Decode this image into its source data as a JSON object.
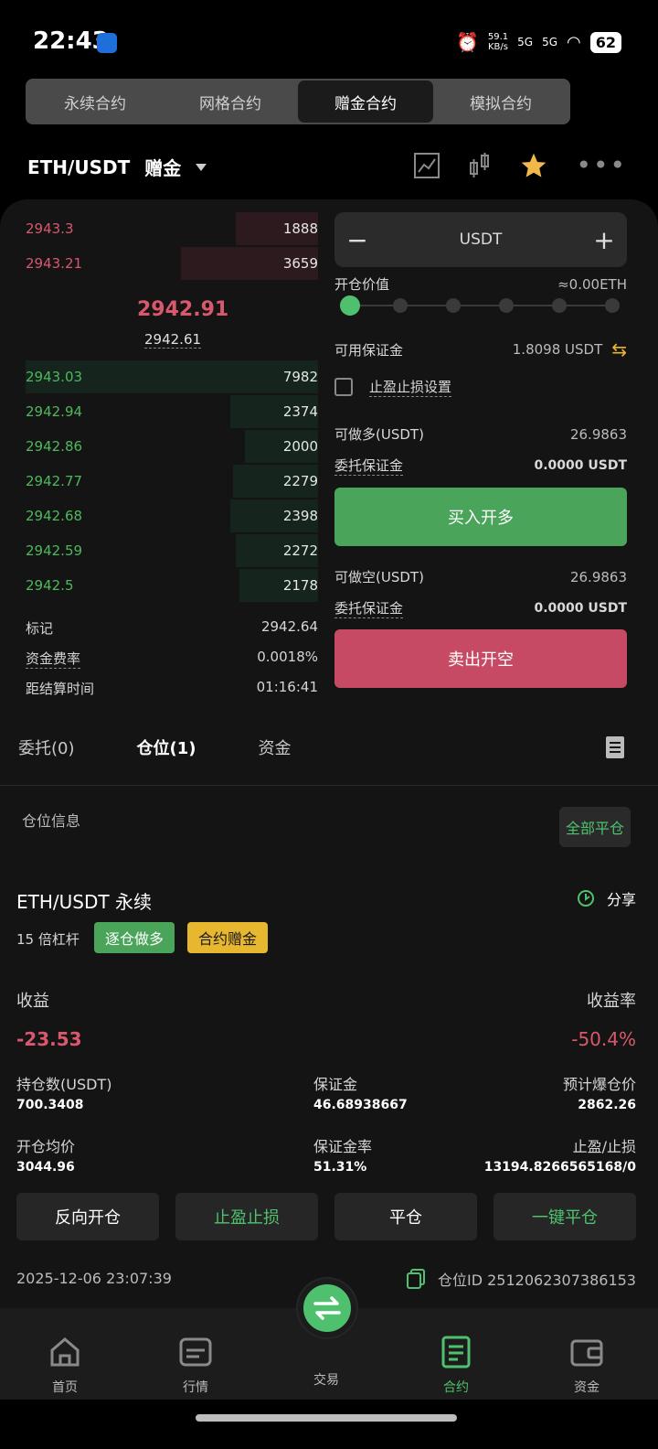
{
  "status_bar": {
    "time": "22:43",
    "net_speed": "59.1\nKB/s",
    "sig1": "5G",
    "sig2": "5G",
    "battery": "62"
  },
  "tabs": [
    "永续合约",
    "网格合约",
    "赠金合约",
    "模拟合约"
  ],
  "header": {
    "pair": "ETH/USDT",
    "mode": "赠金"
  },
  "order_book": {
    "asks": [
      {
        "price": "2943.3",
        "qty": "1888",
        "depth": 0.28
      },
      {
        "price": "2943.21",
        "qty": "3659",
        "depth": 0.47
      }
    ],
    "last_price": "2942.91",
    "mark_price": "2942.61",
    "bids": [
      {
        "price": "2943.03",
        "qty": "7982",
        "depth": 1.0
      },
      {
        "price": "2942.94",
        "qty": "2374",
        "depth": 0.3
      },
      {
        "price": "2942.86",
        "qty": "2000",
        "depth": 0.25
      },
      {
        "price": "2942.77",
        "qty": "2279",
        "depth": 0.29
      },
      {
        "price": "2942.68",
        "qty": "2398",
        "depth": 0.3
      },
      {
        "price": "2942.59",
        "qty": "2272",
        "depth": 0.28
      },
      {
        "price": "2942.5",
        "qty": "2178",
        "depth": 0.27
      }
    ],
    "stats": [
      {
        "label": "标记",
        "value": "2942.64"
      },
      {
        "label": "资金费率",
        "value": "0.0018%"
      },
      {
        "label": "距结算时间",
        "value": "01:16:41"
      }
    ]
  },
  "form": {
    "unit": "USDT",
    "open_value_label": "开仓价值",
    "open_value": "≈0.00ETH",
    "available_label": "可用保证金",
    "available": "1.8098 USDT",
    "tpsl_label": "止盈止损设置",
    "long_label": "可做多(USDT)",
    "long_value": "26.9863",
    "entrust_label": "委托保证金",
    "entrust_value": "0.0000 USDT",
    "buy_label": "买入开多",
    "short_label": "可做空(USDT)",
    "short_value": "26.9863",
    "sell_label": "卖出开空"
  },
  "pos_tabs": [
    "委托(0)",
    "仓位(1)",
    "资金"
  ],
  "position": {
    "section": "仓位信息",
    "close_all": "全部平仓",
    "title": "ETH/USDT 永续",
    "share": "分享",
    "leverage": "15 倍杠杆",
    "tag1": "逐仓做多",
    "tag2": "合约赠金",
    "pnl_label": "收益",
    "pnl": "-23.53",
    "roe_label": "收益率",
    "roe": "-50.4%",
    "size_label": "持仓数(USDT)",
    "size": "700.3408",
    "margin_label": "保证金",
    "margin": "46.68938667",
    "liq_label": "预计爆仓价",
    "liq": "2862.26",
    "entry_label": "开仓均价",
    "entry": "3044.96",
    "mratio_label": "保证金率",
    "mratio": "51.31%",
    "tpsl_label": "止盈/止损",
    "tpsl": "13194.8266565168/0",
    "actions": [
      "反向开仓",
      "止盈止损",
      "平仓",
      "一键平仓"
    ],
    "time": "2025-12-06 23:07:39",
    "pos_id": "仓位ID 2512062307386153"
  },
  "nav": [
    "首页",
    "行情",
    "交易",
    "合约",
    "资金"
  ],
  "colors": {
    "green": "#4fc16e",
    "red": "#d9586e",
    "gold": "#e8b730"
  }
}
